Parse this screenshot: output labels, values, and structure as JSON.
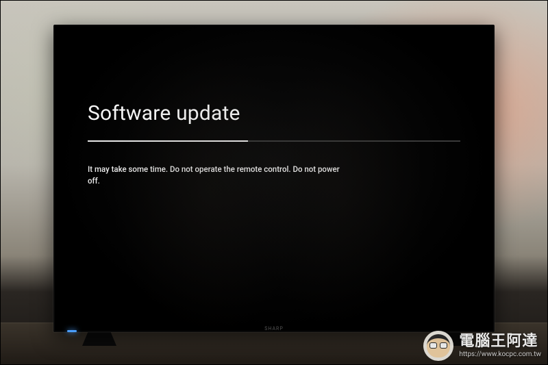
{
  "screen": {
    "title": "Software update",
    "message": "It may take some time. Do not operate the remote control. Do not power off.",
    "progress_percent": 43
  },
  "tv": {
    "brand": "SHARP"
  },
  "watermark": {
    "title": "電腦王阿達",
    "url": "https://www.kocpc.com.tw"
  }
}
